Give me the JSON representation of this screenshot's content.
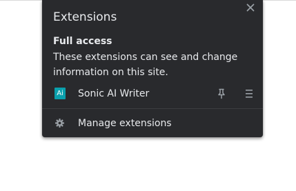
{
  "popup": {
    "title": "Extensions",
    "close_icon": "close-icon",
    "section": {
      "heading": "Full access",
      "description": "These extensions can see and change information on this site."
    },
    "extensions": [
      {
        "icon_text": "Ai",
        "name": "Sonic AI Writer",
        "icon_color": "#0aa0ad"
      }
    ],
    "manage": {
      "label": "Manage extensions",
      "icon": "gear-icon"
    }
  },
  "colors": {
    "popup_bg": "#292a2d",
    "text": "#e8eaed",
    "icon_gray": "#9aa0a6",
    "divider": "#3c3d40"
  }
}
